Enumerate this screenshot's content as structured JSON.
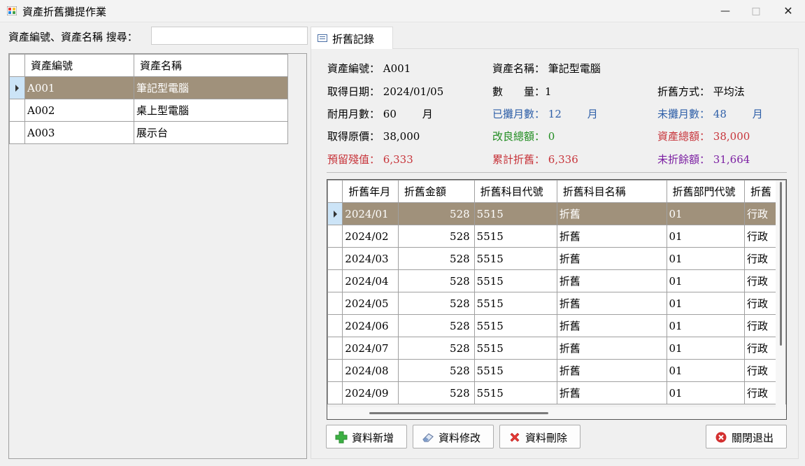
{
  "window": {
    "title": "資產折舊攤提作業"
  },
  "search": {
    "label": "資產編號、資產名稱  搜尋：",
    "value": ""
  },
  "asset_grid": {
    "columns": [
      "資產編號",
      "資產名稱"
    ],
    "rows": [
      [
        "A001",
        "筆記型電腦"
      ],
      [
        "A002",
        "桌上型電腦"
      ],
      [
        "A003",
        "展示台"
      ]
    ]
  },
  "tab": {
    "label": "折舊記錄"
  },
  "details": {
    "asset_no_label": "資產編號：",
    "asset_no": "A001",
    "asset_name_label": "資產名稱：",
    "asset_name": "筆記型電腦",
    "acq_date_label": "取得日期：",
    "acq_date": "2024/01/05",
    "qty_label": "數　　量：",
    "qty": "1",
    "method_label": "折舊方式：",
    "method": "平均法",
    "life_label": "耐用月數：",
    "life": "60",
    "life_unit": "月",
    "amortized_label": "已攤月數：",
    "amortized": "12",
    "amortized_unit": "月",
    "remaining_label": "未攤月數：",
    "remaining": "48",
    "remaining_unit": "月",
    "cost_label": "取得原價：",
    "cost": "38,000",
    "improve_label": "改良總額：",
    "improve": "0",
    "total_label": "資產總額：",
    "total": "38,000",
    "salvage_label": "預留殘值：",
    "salvage": "6,333",
    "accum_label": "累計折舊：",
    "accum": "6,336",
    "undep_label": "未折餘額：",
    "undep": "31,664"
  },
  "dep_grid": {
    "columns": [
      "折舊年月",
      "折舊金額",
      "折舊科目代號",
      "折舊科目名稱",
      "折舊部門代號",
      "折舊"
    ],
    "rows": [
      [
        "2024/01",
        "528",
        "5515",
        "折舊",
        "01",
        "行政"
      ],
      [
        "2024/02",
        "528",
        "5515",
        "折舊",
        "01",
        "行政"
      ],
      [
        "2024/03",
        "528",
        "5515",
        "折舊",
        "01",
        "行政"
      ],
      [
        "2024/04",
        "528",
        "5515",
        "折舊",
        "01",
        "行政"
      ],
      [
        "2024/05",
        "528",
        "5515",
        "折舊",
        "01",
        "行政"
      ],
      [
        "2024/06",
        "528",
        "5515",
        "折舊",
        "01",
        "行政"
      ],
      [
        "2024/07",
        "528",
        "5515",
        "折舊",
        "01",
        "行政"
      ],
      [
        "2024/08",
        "528",
        "5515",
        "折舊",
        "01",
        "行政"
      ],
      [
        "2024/09",
        "528",
        "5515",
        "折舊",
        "01",
        "行政"
      ]
    ]
  },
  "buttons": {
    "add": "資料新增",
    "edit": "資料修改",
    "delete": "資料刪除",
    "close": "關閉退出"
  },
  "icons": {
    "app": "app-icon",
    "tab": "form-icon",
    "add": "plus-icon",
    "edit": "eraser-icon",
    "delete": "x-icon",
    "close": "close-circle-icon"
  },
  "colors": {
    "selected_row": "#a0917b",
    "row_header_selected": "#cce4f7"
  }
}
